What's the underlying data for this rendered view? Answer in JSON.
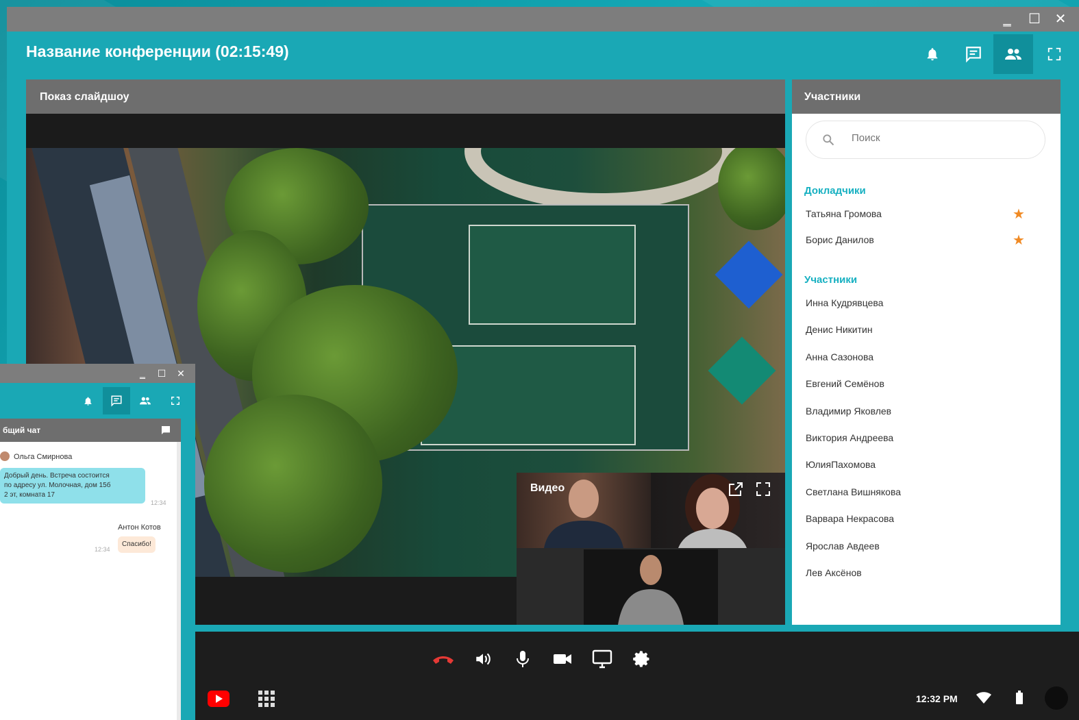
{
  "window": {
    "minimize_glyph": "‗",
    "maximize_glyph": "☐",
    "close_glyph": "✕"
  },
  "conference": {
    "title": "Название конференции (02:15:49)",
    "header_icons": [
      "bell-icon",
      "chat-icon",
      "people-icon",
      "fullscreen-icon"
    ],
    "active_header_icon": "people-icon"
  },
  "slideshow": {
    "title": "Показ слайдшоу"
  },
  "video": {
    "label": "Видео"
  },
  "participants": {
    "title": "Участники",
    "search_placeholder": "Поиск",
    "speakers_title": "Докладчики",
    "speakers": [
      "Татьяна Громова",
      "Борис Данилов"
    ],
    "members_title": "Участники",
    "members": [
      "Инна Кудрявцева",
      "Денис Никитин",
      "Анна Сазонова",
      "Евгений Семёнов",
      "Владимир Яковлев",
      "Виктория Андреева",
      "ЮлияПахомова",
      "Светлана Вишнякова",
      "Варвара Некрасова",
      "Ярослав Авдеев",
      "Лев Аксёнов"
    ],
    "star_glyph": "★"
  },
  "controls": {
    "icons": [
      "hangup-icon",
      "speaker-icon",
      "microphone-icon",
      "camera-icon",
      "screen-share-icon",
      "settings-icon"
    ],
    "clock": "12:32 PM"
  },
  "mini_window": {
    "chat_title": "бщий чат",
    "messages": [
      {
        "author": "Ольга Смирнова",
        "lines": [
          "Добрый день. Встреча состоится",
          "по адресу ул. Молочная, дом 15б",
          "2 эт, комната 17"
        ],
        "time": "12:34"
      },
      {
        "author": "Антон Котов",
        "lines": [
          "Спасибо!"
        ],
        "time": "12:34"
      }
    ]
  },
  "colors": {
    "teal": "#1aa8b5",
    "accent": "#16b0c1",
    "star": "#f08a24",
    "hangup": "#e53935"
  }
}
